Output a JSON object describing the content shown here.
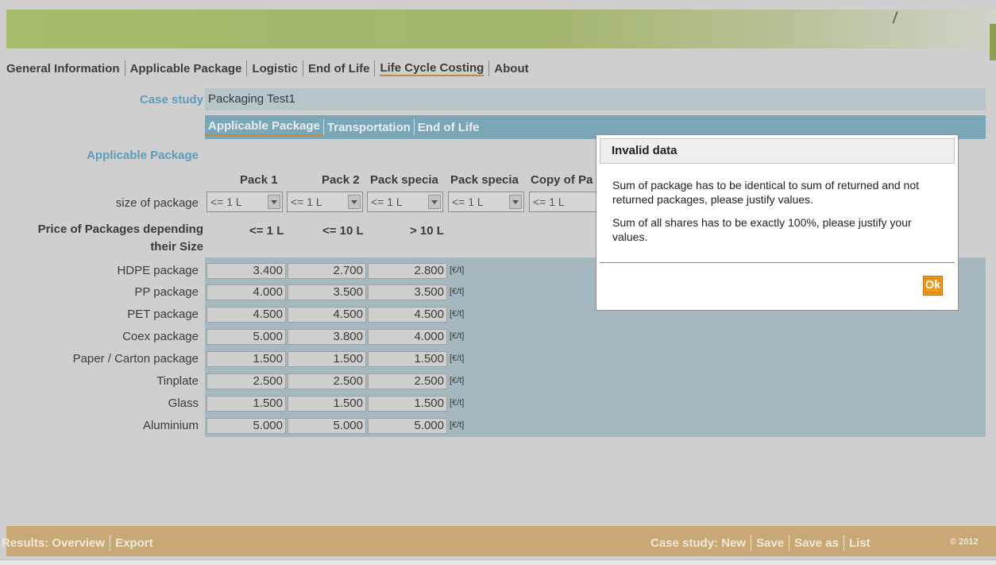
{
  "main_nav": [
    "General Information",
    "Applicable Package",
    "Logistic",
    "End of Life",
    "Life Cycle Costing",
    "About"
  ],
  "main_nav_active": "Life Cycle Costing",
  "case_study": {
    "label": "Case study",
    "value": "Packaging Test1"
  },
  "sub_nav": [
    "Applicable Package",
    "Transportation",
    "End of Life"
  ],
  "sub_nav_active": "Applicable Package",
  "section_label": "Applicable Package",
  "pack_headers": [
    "Pack 1",
    "Pack 2",
    "Pack specia",
    "Pack specia",
    "Copy of Pa"
  ],
  "size_of_package": {
    "label": "size of package",
    "values": [
      "<= 1 L",
      "<= 1 L",
      "<= 1 L",
      "<= 1 L",
      "<= 1 L"
    ]
  },
  "price_section": {
    "label_line1": "Price of Packages depending",
    "label_line2": "their Size",
    "size_headers": [
      "<= 1 L",
      "<= 10 L",
      "> 10 L"
    ]
  },
  "unit": "[€/t]",
  "price_rows": [
    {
      "label": "HDPE package",
      "values": [
        "3.400",
        "2.700",
        "2.800"
      ]
    },
    {
      "label": "PP package",
      "values": [
        "4.000",
        "3.500",
        "3.500"
      ]
    },
    {
      "label": "PET package",
      "values": [
        "4.500",
        "4.500",
        "4.500"
      ]
    },
    {
      "label": "Coex package",
      "values": [
        "5.000",
        "3.800",
        "4.000"
      ]
    },
    {
      "label": "Paper / Carton package",
      "values": [
        "1.500",
        "1.500",
        "1.500"
      ]
    },
    {
      "label": "Tinplate",
      "values": [
        "2.500",
        "2.500",
        "2.500"
      ]
    },
    {
      "label": "Glass",
      "values": [
        "1.500",
        "1.500",
        "1.500"
      ]
    },
    {
      "label": "Aluminium",
      "values": [
        "5.000",
        "5.000",
        "5.000"
      ]
    }
  ],
  "footer": {
    "results_label": "Results:",
    "overview": "Overview",
    "export": "Export",
    "case_study_label": "Case study:",
    "new": "New",
    "save": "Save",
    "save_as": "Save as",
    "list": "List",
    "copyright": "© 2012"
  },
  "dialog": {
    "title": "Invalid data",
    "message1": "Sum of package has to be identical to sum of returned and not returned packages, please justify values.",
    "message2": "Sum of all shares has to be exactly 100%, please justify your values.",
    "ok": "Ok"
  },
  "colors": {
    "footer": "#c8a976",
    "subnav": "#7aa6b8",
    "ok_button": "#f39a1d",
    "label_blue": "#5c9cbc"
  }
}
